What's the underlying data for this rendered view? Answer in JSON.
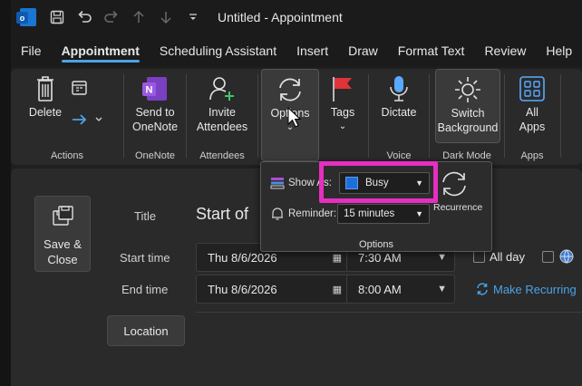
{
  "window": {
    "title": "Untitled  -  Appointment"
  },
  "menu": [
    "File",
    "Appointment",
    "Scheduling Assistant",
    "Insert",
    "Draw",
    "Format Text",
    "Review",
    "Help"
  ],
  "ribbon": {
    "delete": "Delete",
    "groups": {
      "actions": "Actions",
      "onenote": "OneNote",
      "attendees": "Attendees",
      "voice": "Voice",
      "darkmode": "Dark Mode",
      "apps": "Apps"
    },
    "send_to_onenote": [
      "Send to",
      "OneNote"
    ],
    "invite_attendees": [
      "Invite",
      "Attendees"
    ],
    "options": "Options",
    "tags": "Tags",
    "dictate": "Dictate",
    "switch_background": [
      "Switch",
      "Background"
    ],
    "all_apps": [
      "All",
      "Apps"
    ]
  },
  "form": {
    "save_close": [
      "Save &",
      "Close"
    ],
    "title_label": "Title",
    "title_value": "Start of",
    "start_time_label": "Start time",
    "start_date": "Thu 8/6/2026",
    "start_time": "7:30 AM",
    "end_time_label": "End time",
    "end_date": "Thu 8/6/2026",
    "end_time": "8:00 AM",
    "all_day": "All day",
    "make_recurring": "Make Recurring",
    "location": "Location"
  },
  "options_popup": {
    "show_as_label": "Show As:",
    "show_as_value": "Busy",
    "reminder_label": "Reminder:",
    "reminder_value": "15 minutes",
    "recurrence": "Recurrence",
    "group_label": "Options"
  },
  "colors": {
    "accent": "#4aa3e8",
    "highlight": "#e62fc0",
    "busy": "#1e6fd9"
  }
}
